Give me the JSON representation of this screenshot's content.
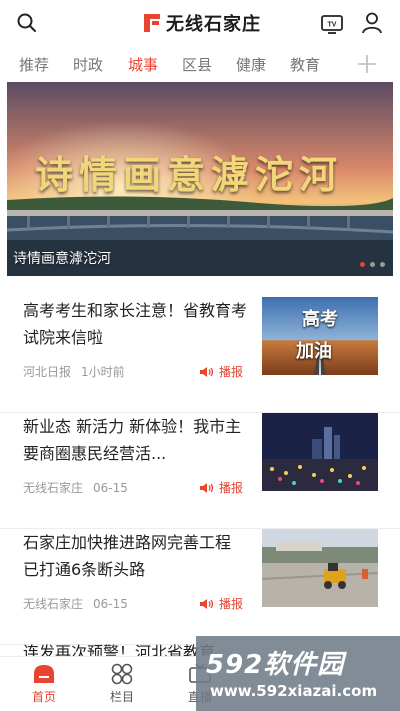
{
  "header": {
    "app_title": "无线石家庄",
    "search_icon": "search-icon",
    "tv_icon": "tv-icon",
    "user_icon": "user-icon",
    "tv_badge": "TV"
  },
  "tabs": [
    {
      "label": "推荐",
      "active": false
    },
    {
      "label": "时政",
      "active": false
    },
    {
      "label": "城事",
      "active": true
    },
    {
      "label": "区县",
      "active": false
    },
    {
      "label": "健康",
      "active": false
    },
    {
      "label": "教育",
      "active": false
    }
  ],
  "banner": {
    "title": "诗情画意滹沱河",
    "calligraphy": "诗情画意滹沱河",
    "slide_count": 3,
    "active_slide": 1
  },
  "news": [
    {
      "title": "高考考生和家长注意！省教育考试院来信啦",
      "source": "河北日报",
      "time": "1小时前",
      "broadcast": "播报",
      "thumb_text": [
        "高考",
        "加油"
      ]
    },
    {
      "title": "新业态 新活力 新体验！我市主要商圈惠民经营活...",
      "source": "无线石家庄",
      "time": "06-15",
      "broadcast": "播报"
    },
    {
      "title": "石家庄加快推进路网完善工程 已打通6条断头路",
      "source": "无线石家庄",
      "time": "06-15",
      "broadcast": "播报"
    },
    {
      "title": "连发再次预警！河北省教育",
      "partial": true
    }
  ],
  "bottom_nav": [
    {
      "label": "首页",
      "icon": "home-icon",
      "active": true
    },
    {
      "label": "栏目",
      "icon": "grid-icon",
      "active": false
    },
    {
      "label": "直播",
      "icon": "live-icon",
      "active": false
    }
  ],
  "watermark": {
    "brand_number": "592",
    "brand_text": "软件园",
    "url": "www.592xiazai.com"
  },
  "colors": {
    "accent": "#e8442f",
    "text": "#222222",
    "muted": "#999999"
  }
}
